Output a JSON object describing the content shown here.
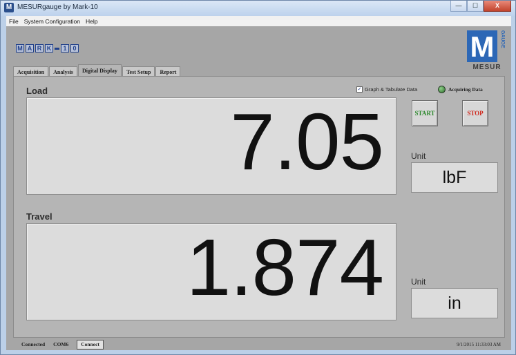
{
  "window": {
    "title": "MESURgauge by Mark-10",
    "app_icon_letter": "M",
    "controls": {
      "minimize": "—",
      "maximize": "☐",
      "close": "X"
    }
  },
  "menu": {
    "items": [
      "File",
      "System Configuration",
      "Help"
    ]
  },
  "logo": {
    "letters": [
      "M",
      "A",
      "R",
      "K",
      "1",
      "0"
    ]
  },
  "brand": {
    "m": "M",
    "word": "MESUR",
    "gauge": "GAUGE"
  },
  "tabs": [
    {
      "label": "Acquisition",
      "active": false
    },
    {
      "label": "Analysis",
      "active": false
    },
    {
      "label": "Digital Display",
      "active": true
    },
    {
      "label": "Test Setup",
      "active": false
    },
    {
      "label": "Report",
      "active": false
    }
  ],
  "graph_tabulate": {
    "label": "Graph & Tabulate Data",
    "checked": true,
    "mark": "✓"
  },
  "acquiring": {
    "label": "Acquiring Data",
    "led_color": "#3f8f3b"
  },
  "buttons": {
    "start": "START",
    "stop": "STOP",
    "start_color": "#2f8a2f",
    "stop_color": "#d02a1f"
  },
  "load": {
    "label": "Load",
    "value": "7.05",
    "unit_label": "Unit",
    "unit": "lbF"
  },
  "travel": {
    "label": "Travel",
    "value": "1.874",
    "unit_label": "Unit",
    "unit": "in"
  },
  "status": {
    "connection": "Connected",
    "port": "COM6",
    "connect_button": "Connect",
    "timestamp": "9/1/2015 11:33:03 AM"
  }
}
